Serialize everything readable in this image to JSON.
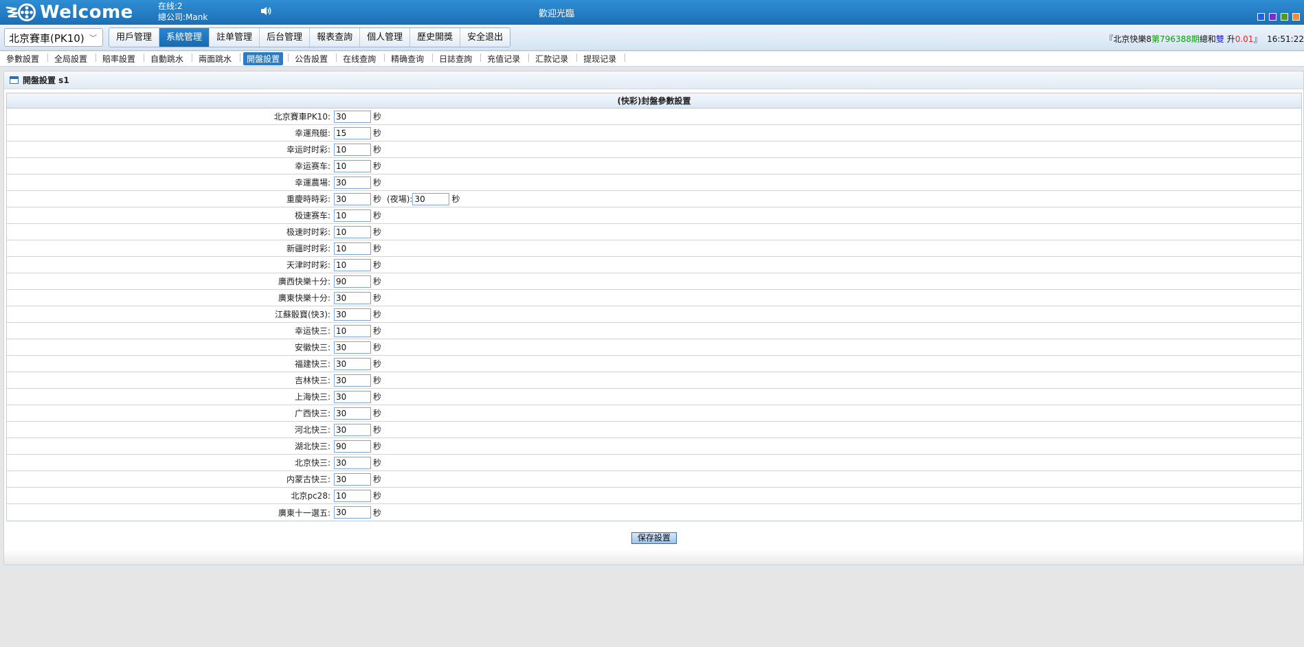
{
  "header": {
    "logo_text": "Welcome",
    "online": "在线:2",
    "company": "總公司:Mank",
    "welcome_message": "歡迎光臨",
    "skin_colors": [
      "#1a63e8",
      "#7a2bc8",
      "#4f9d1f",
      "#f28a3c"
    ]
  },
  "nav": {
    "lottery_selected": "北京賽車(PK10)",
    "menus": [
      {
        "label": "用戶管理",
        "active": false
      },
      {
        "label": "系統管理",
        "active": true
      },
      {
        "label": "註单管理",
        "active": false
      },
      {
        "label": "后台管理",
        "active": false
      },
      {
        "label": "報表查詢",
        "active": false
      },
      {
        "label": "個人管理",
        "active": false
      },
      {
        "label": "歷史開獎",
        "active": false
      },
      {
        "label": "安全退出",
        "active": false
      }
    ],
    "draw_info": {
      "prefix": "『北京快樂8",
      "issue": "第796388期",
      "sum_label": "總和",
      "parity": "雙",
      "trend_label": " 升",
      "trend_value": "0.01",
      "suffix": "』",
      "time": "16:51:22"
    }
  },
  "submenu": [
    {
      "label": "參數設置",
      "active": false
    },
    {
      "label": "全局設置",
      "active": false
    },
    {
      "label": "賠率設置",
      "active": false
    },
    {
      "label": "自動跳水",
      "active": false
    },
    {
      "label": "兩面跳水",
      "active": false
    },
    {
      "label": "開盤設置",
      "active": true
    },
    {
      "label": "公告設置",
      "active": false
    },
    {
      "label": "在线查詢",
      "active": false
    },
    {
      "label": "精确查询",
      "active": false
    },
    {
      "label": "日誌查詢",
      "active": false
    },
    {
      "label": "充值记录",
      "active": false
    },
    {
      "label": "汇款记录",
      "active": false
    },
    {
      "label": "提现记录",
      "active": false
    }
  ],
  "panel": {
    "title": "開盤設置 s1",
    "grid_title": "(快彩)封盤參數設置",
    "unit": "秒",
    "night_label": "(夜場):",
    "rows": [
      {
        "label": "北京賽車PK10:",
        "value": "30"
      },
      {
        "label": "幸運飛艇:",
        "value": "15"
      },
      {
        "label": "幸运时时彩:",
        "value": "10"
      },
      {
        "label": "幸运赛车:",
        "value": "10"
      },
      {
        "label": "幸運農場:",
        "value": "30"
      },
      {
        "label": "重慶時時彩:",
        "value": "30",
        "night_value": "30"
      },
      {
        "label": "极速赛车:",
        "value": "10"
      },
      {
        "label": "极速时时彩:",
        "value": "10"
      },
      {
        "label": "新疆时时彩:",
        "value": "10"
      },
      {
        "label": "天津时时彩:",
        "value": "10"
      },
      {
        "label": "廣西快樂十分:",
        "value": "90"
      },
      {
        "label": "廣東快樂十分:",
        "value": "30"
      },
      {
        "label": "江蘇骰寶(快3):",
        "value": "30"
      },
      {
        "label": "幸运快三:",
        "value": "10"
      },
      {
        "label": "安徽快三:",
        "value": "30"
      },
      {
        "label": "福建快三:",
        "value": "30"
      },
      {
        "label": "吉林快三:",
        "value": "30"
      },
      {
        "label": "上海快三:",
        "value": "30"
      },
      {
        "label": "广西快三:",
        "value": "30"
      },
      {
        "label": "河北快三:",
        "value": "30"
      },
      {
        "label": "湖北快三:",
        "value": "90"
      },
      {
        "label": "北京快三:",
        "value": "30"
      },
      {
        "label": "内蒙古快三:",
        "value": "30"
      },
      {
        "label": "北京pc28:",
        "value": "10"
      },
      {
        "label": "廣東十一選五:",
        "value": "30"
      }
    ],
    "save_label": "保存設置"
  }
}
